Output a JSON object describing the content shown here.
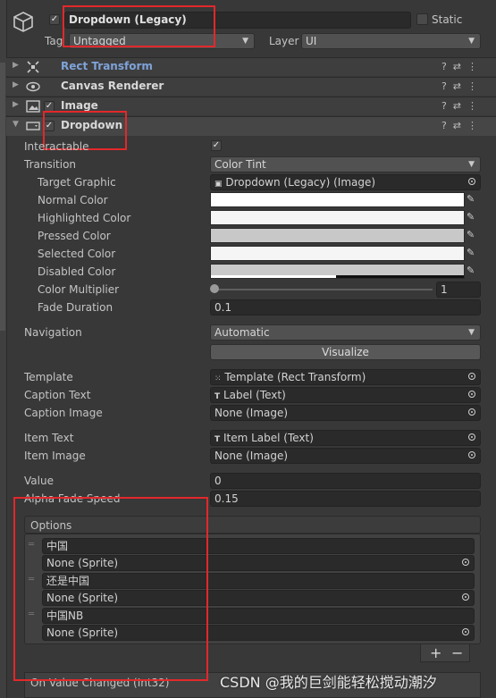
{
  "header": {
    "active_checked": true,
    "object_name": "Dropdown (Legacy)",
    "static_label": "Static",
    "tag_label": "Tag",
    "tag_value": "Untagged",
    "layer_label": "Layer",
    "layer_value": "UI"
  },
  "components": [
    {
      "name": "Rect Transform",
      "icon": "rect-transform-icon",
      "has_checkbox": false,
      "name_color": "#7fa3d9"
    },
    {
      "name": "Canvas Renderer",
      "icon": "eye-icon",
      "has_checkbox": false
    },
    {
      "name": "Image",
      "icon": "image-icon",
      "has_checkbox": true
    },
    {
      "name": "Dropdown",
      "icon": "dropdown-icon",
      "has_checkbox": true
    }
  ],
  "dropdown": {
    "interactable_label": "Interactable",
    "interactable_checked": true,
    "transition_label": "Transition",
    "transition_value": "Color Tint",
    "target_graphic_label": "Target Graphic",
    "target_graphic_value": "Dropdown (Legacy) (Image)",
    "colors": [
      {
        "label": "Normal Color",
        "color": "#ffffff"
      },
      {
        "label": "Highlighted Color",
        "color": "#f5f5f5"
      },
      {
        "label": "Pressed Color",
        "color": "#c8c8c8"
      },
      {
        "label": "Selected Color",
        "color": "#f5f5f5"
      },
      {
        "label": "Disabled Color",
        "color": "#c8c8c8"
      }
    ],
    "color_multiplier_label": "Color Multiplier",
    "color_multiplier_value": "1",
    "fade_duration_label": "Fade Duration",
    "fade_duration_value": "0.1",
    "navigation_label": "Navigation",
    "navigation_value": "Automatic",
    "visualize_label": "Visualize",
    "template_label": "Template",
    "template_value": "Template (Rect Transform)",
    "caption_text_label": "Caption Text",
    "caption_text_value": "Label (Text)",
    "caption_image_label": "Caption Image",
    "caption_image_value": "None (Image)",
    "item_text_label": "Item Text",
    "item_text_value": "Item Label (Text)",
    "item_image_label": "Item Image",
    "item_image_value": "None (Image)",
    "value_label": "Value",
    "value_value": "0",
    "alpha_fade_label": "Alpha Fade Speed",
    "alpha_fade_value": "0.15",
    "options_label": "Options",
    "options": [
      {
        "text": "中国",
        "sprite": "None (Sprite)"
      },
      {
        "text": "还是中国",
        "sprite": "None (Sprite)"
      },
      {
        "text": "中国NB",
        "sprite": "None (Sprite)"
      }
    ],
    "add_label": "+",
    "remove_label": "−",
    "on_value_changed_label": "On Value Changed (Int32)"
  },
  "watermark": "CSDN @我的巨剑能轻松搅动潮汐",
  "highlight_color": "#e2282a"
}
